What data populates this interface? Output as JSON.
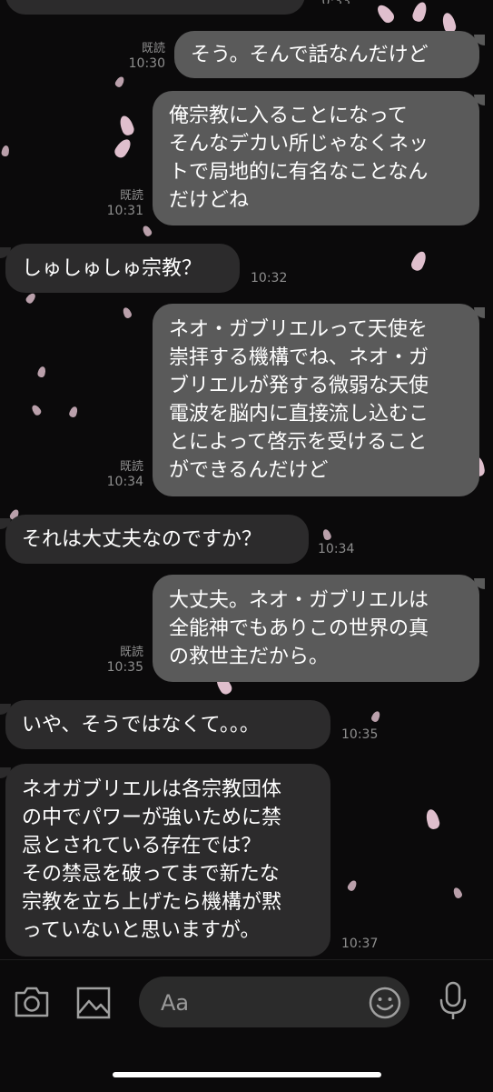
{
  "messages": [
    {
      "dir": "out",
      "text": "そう。そんで話なんだけど",
      "read": "既読",
      "time": "10:30"
    },
    {
      "dir": "out",
      "text": "俺宗教に入ることになって\nそんなデカい所じゃなくネッ\nトで局地的に有名なことなん\nだけどね",
      "read": "既読",
      "time": "10:31"
    },
    {
      "dir": "in",
      "text": "しゅしゅしゅ宗教？",
      "time": "10:32"
    },
    {
      "dir": "out",
      "text": "ネオ・ガブリエルって天使を\n崇拝する機構でね、ネオ・ガ\nブリエルが発する微弱な天使\n電波を脳内に直接流し込むこ\nとによって啓示を受けること\nができるんだけど",
      "read": "既読",
      "time": "10:34"
    },
    {
      "dir": "in",
      "text": "それは大丈夫なのですか？",
      "time": "10:34"
    },
    {
      "dir": "out",
      "text": "大丈夫。ネオ・ガブリエルは\n全能神でもありこの世界の真\nの救世主だから。",
      "read": "既読",
      "time": "10:35"
    },
    {
      "dir": "in",
      "text": "いや、そうではなくて。。。",
      "time": "10:35"
    },
    {
      "dir": "in",
      "text": "ネオガブリエルは各宗教団体\nの中でパワーが強いために禁\n忌とされている存在では？\nその禁忌を破ってまで新たな\n宗教を立ち上げたら機構が黙\nっていないと思いますが。",
      "time": "10:37"
    }
  ],
  "input": {
    "placeholder": "Aa"
  },
  "colors": {
    "background": "#0b0a0b",
    "outgoing_bubble": "#5a5a5a",
    "incoming_bubble": "#2c2b2c",
    "petal": "#f6d3e2"
  },
  "icons": [
    "camera-icon",
    "image-icon",
    "emoji-icon",
    "microphone-icon"
  ]
}
